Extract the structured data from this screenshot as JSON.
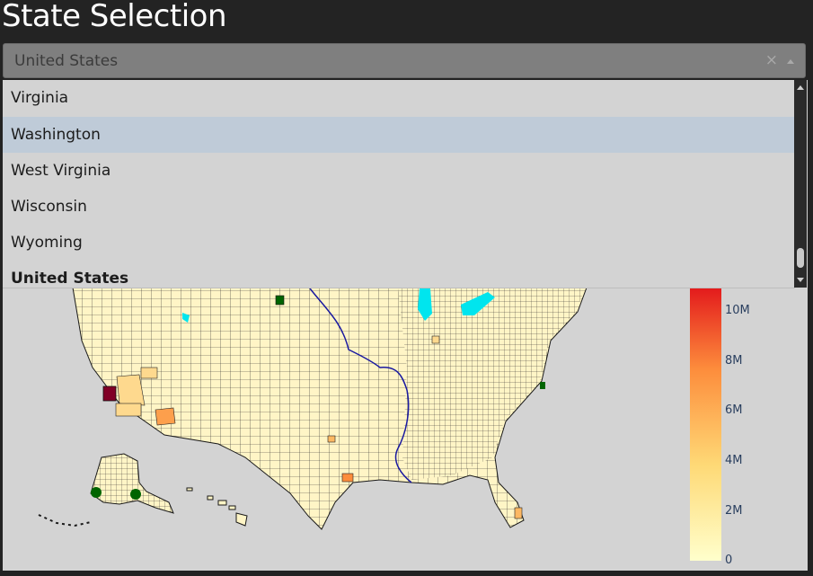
{
  "page": {
    "title": "State Selection"
  },
  "state_select": {
    "value": "United States",
    "clear_glyph": "×",
    "options": [
      {
        "label": "Virginia"
      },
      {
        "label": "Washington"
      },
      {
        "label": "West Virginia"
      },
      {
        "label": "Wisconsin"
      },
      {
        "label": "Wyoming"
      },
      {
        "label": "United States"
      }
    ],
    "highlighted_option": "Washington",
    "selected_option": "United States"
  },
  "colorbar": {
    "ticks": [
      "10M",
      "8M",
      "6M",
      "4M",
      "2M",
      "0"
    ],
    "colors": [
      "#ffffcc",
      "#fed976",
      "#fd8d3c",
      "#e31a1c"
    ]
  },
  "map": {
    "background": "#d3d3d3",
    "land_fill": "#fff5c6",
    "water_color": "#00e5ee",
    "river_color": "#1a1aa0"
  }
}
